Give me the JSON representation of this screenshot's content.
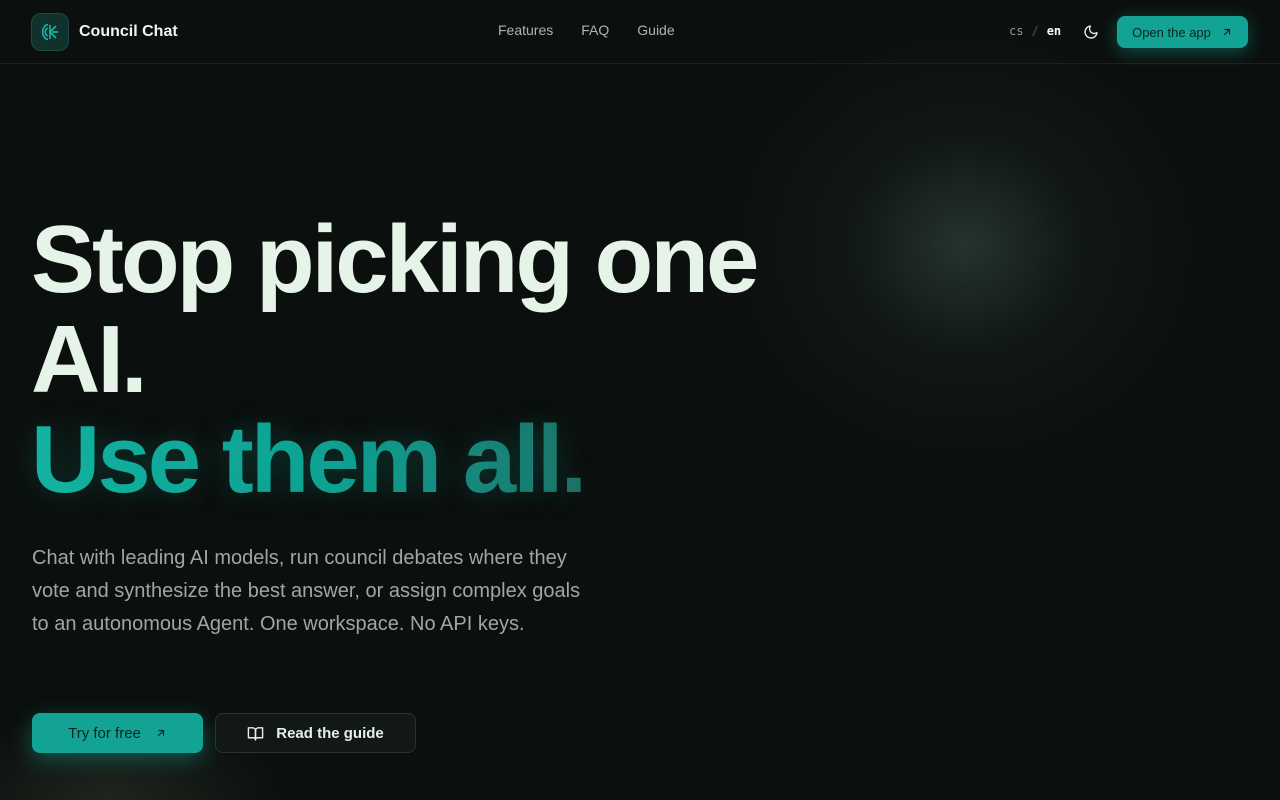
{
  "header": {
    "brand_name": "Council Chat",
    "nav": [
      {
        "label": "Features"
      },
      {
        "label": "FAQ"
      },
      {
        "label": "Guide"
      }
    ],
    "lang": {
      "cs": "cs",
      "sep": "/",
      "en": "en"
    },
    "theme_icon": "moon-icon",
    "open_app_label": "Open the app"
  },
  "hero": {
    "line1": "Stop picking one",
    "line2": "AI.",
    "line3": "Use them all.",
    "description": "Chat with leading AI models, run council debates where they vote and synthesize the best answer, or assign complex goals to an autonomous Agent. One workspace. No API keys.",
    "cta_primary": "Try for free",
    "cta_secondary": "Read the guide"
  },
  "colors": {
    "accent": "#13a394",
    "background": "#0b0f0d",
    "heading": "#e5f3e9"
  }
}
